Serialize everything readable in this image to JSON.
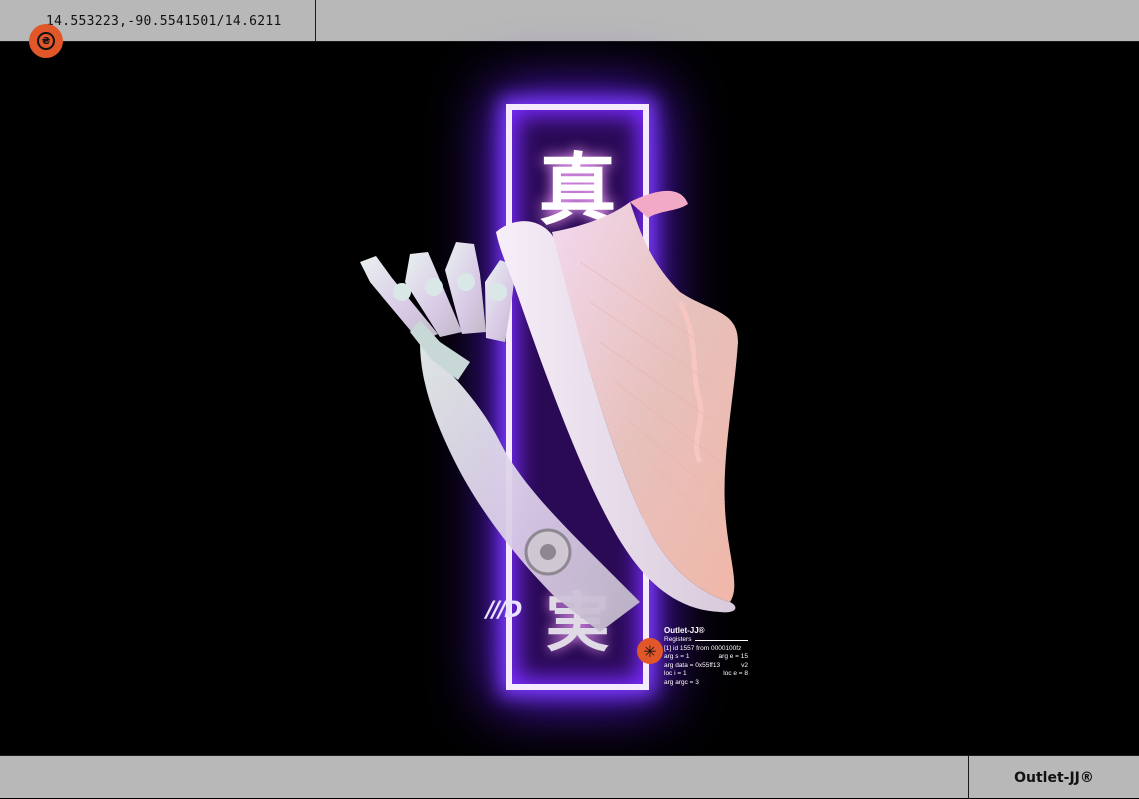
{
  "header": {
    "coordinates": "14.553223,-90.5541501/14.6211"
  },
  "icons": {
    "logo": "circular-logo-icon",
    "info": "asterisk-icon"
  },
  "hero": {
    "kanji_top": "真",
    "kanji_bottom": "実",
    "small_logo": "///D"
  },
  "info_panel": {
    "brand": "Outlet-JJ®",
    "registers_label": "Registers",
    "line1": "[1] id 1557 from 0000100fz",
    "line2_left": "arg s = 1",
    "line2_right": "arg e = 15",
    "line3_left": "arg data = 0x55ff13",
    "line3_right": "v2",
    "line4_left": "loc i = 1",
    "line4_right": "loc e = 8",
    "line5": "arg argc = 3"
  },
  "footer": {
    "brand": "Outlet-JJ®"
  },
  "colors": {
    "bar_gray": "#b8b8b8",
    "accent_orange": "#e2572a",
    "neon_purple": "#7d3cff",
    "background": "#000000"
  }
}
